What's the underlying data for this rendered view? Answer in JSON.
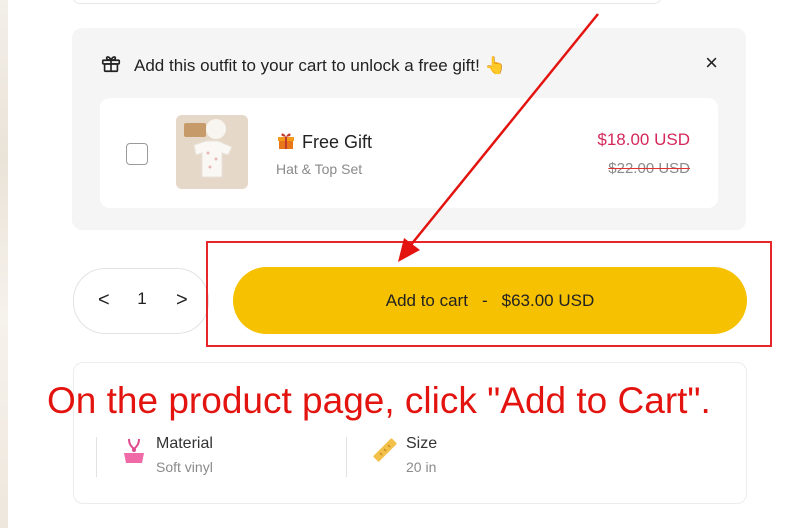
{
  "gift_panel": {
    "header_text": "Add this outfit to your cart to unlock a free gift! 👆",
    "close_label": "×",
    "item": {
      "title": "Free Gift",
      "subtitle": "Hat & Top Set",
      "sale_price": "$18.00 USD",
      "original_price": "$22.00 USD",
      "checked": false
    }
  },
  "quantity": {
    "decrement_label": "<",
    "value": "1",
    "increment_label": ">"
  },
  "add_to_cart": {
    "label": "Add to cart",
    "separator": "-",
    "price": "$63.00 USD"
  },
  "specs": [
    {
      "label": "Material",
      "value": "Soft vinyl",
      "icon": "material-icon"
    },
    {
      "label": "Size",
      "value": "20 in",
      "icon": "ruler-icon"
    }
  ],
  "annotation": {
    "text": "On the product page, click \"Add to Cart\"."
  },
  "colors": {
    "accent": "#f6c100",
    "sale_price": "#d4285a",
    "annotation_red": "#e3140f"
  }
}
